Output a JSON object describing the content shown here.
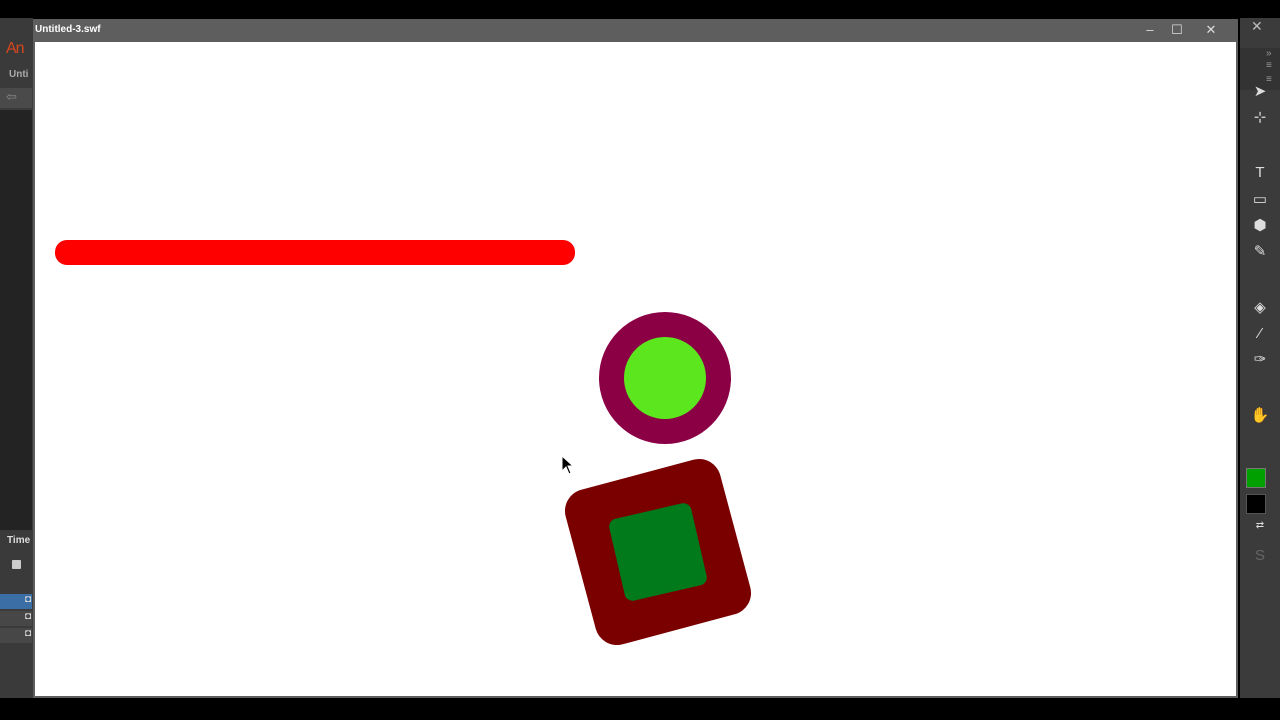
{
  "app": {
    "logo": "An",
    "doc_tab": "Unti",
    "panel_label": "Time"
  },
  "player": {
    "title": "Untitled-3.swf",
    "minimize_glyph": "–",
    "maximize_glyph": "☐",
    "close_glyph": "✕"
  },
  "tools_panel": {
    "close_glyph": "✕",
    "icons": [
      "selection-tool-icon",
      "subselection-tool-icon",
      "text-tool-icon",
      "rectangle-tool-icon",
      "polystar-tool-icon",
      "brush-tool-icon",
      "paint-bucket-icon",
      "eyedropper-icon",
      "bone-tool-icon",
      "hand-tool-icon"
    ],
    "stroke_color": "#00a000",
    "fill_color": "#000000"
  },
  "stage": {
    "background": "#ffffff",
    "bar_color": "#ff0000",
    "circle_outer_color": "#8b0045",
    "circle_inner_color": "#5ce61e",
    "square_outer_color": "#7a0000",
    "square_inner_color": "#007a1a"
  }
}
